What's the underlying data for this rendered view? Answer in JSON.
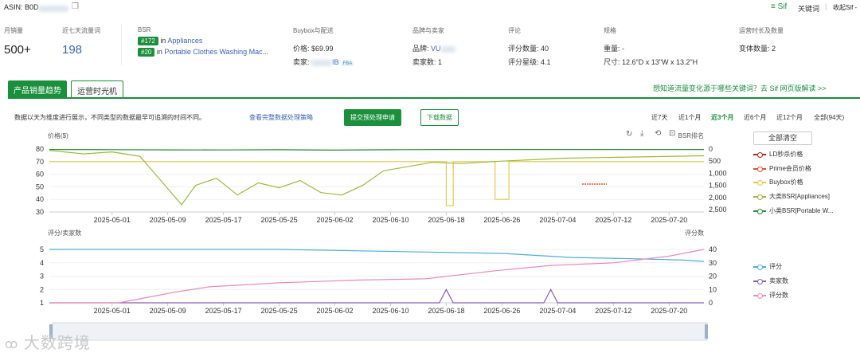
{
  "header": {
    "asin_label": "ASIN: B0D",
    "copy_icon": "copy-icon",
    "sif_logo": "≡ Sif",
    "sif_keyword": "关键词",
    "separator": "|",
    "fold_label": "收起Sif -"
  },
  "stats": {
    "monthly_sales": {
      "label": "月销量",
      "value": "500+"
    },
    "traffic7": {
      "label": "近七天流量词",
      "value": "198"
    },
    "bsr": {
      "label": "BSR",
      "rank1": "#172",
      "cat1": "Appliances",
      "rank2": "#20",
      "cat2": "Portable Clothes Washing Mac...",
      "in": "in"
    },
    "buybox": {
      "label": "Buybox与配送",
      "price_label": "价格:",
      "price": "$69.99",
      "seller_label": "卖家:",
      "seller_suffix": "IB",
      "fba": "FBA"
    },
    "brand": {
      "label": "品牌与卖家",
      "brand_label": "品牌:",
      "brand_value": "VU",
      "sellers_label": "卖家数:",
      "sellers_value": "1"
    },
    "review": {
      "label": "评论",
      "count_label": "评分数量:",
      "count": "40",
      "rating_label": "评分星级:",
      "rating": "4.1"
    },
    "spec": {
      "label": "规格",
      "weight_label": "重量:",
      "weight": "-",
      "size_label": "尺寸:",
      "size": "12.6\"D x 13\"W x 13.2\"H"
    },
    "ops": {
      "label": "运营时长及数量",
      "variants_label": "变体数量:",
      "variants": "2"
    }
  },
  "tabs": [
    "产品销量趋势",
    "运营时光机"
  ],
  "promo": "想知道流量变化源于哪些关键词？去 Sif 网页版解读 >>",
  "toolbar": {
    "note": "数据以天为维度进行展示，不同类型的数据最早可追溯的时间不同。",
    "note_link": "查看完整数据处理策略",
    "submit": "提交预处理申请",
    "download": "下载数据",
    "ranges": [
      "近7天",
      "近1个月",
      "近3个月",
      "近6个月",
      "近12个月",
      "全部(94天)"
    ],
    "active_range": "近3个月"
  },
  "legend_top": {
    "clear": "全部清空",
    "items": [
      {
        "name": "LD秒杀价格",
        "color": "#b22222"
      },
      {
        "name": "Prime会员价格",
        "color": "#e8502a"
      },
      {
        "name": "Buybox价格",
        "color": "#e8c84a"
      },
      {
        "name": "大类BSR[Appliances]",
        "color": "#9bbb3a"
      },
      {
        "name": "小类BSR[Portable W...",
        "color": "#2e8b3a"
      }
    ]
  },
  "legend_bottom": {
    "items": [
      {
        "name": "评分",
        "color": "#4aaed6"
      },
      {
        "name": "卖家数",
        "color": "#8a5fb5"
      },
      {
        "name": "评分数",
        "color": "#e88aba"
      }
    ]
  },
  "watermark": "大数跨境",
  "chart_data": [
    {
      "type": "line",
      "title": "",
      "ylabel": "价格($)",
      "y2label": "BSR排名",
      "x": [
        "2025-05-01",
        "2025-05-09",
        "2025-05-17",
        "2025-05-25",
        "2025-06-02",
        "2025-06-10",
        "2025-06-18",
        "2025-06-26",
        "2025-07-04",
        "2025-07-12",
        "2025-07-20"
      ],
      "yticks": [
        80,
        70,
        60,
        50,
        40,
        30
      ],
      "y2ticks": [
        "0",
        "500",
        "1,000",
        "1,500",
        "2,000",
        "2,500"
      ],
      "ylim": [
        30,
        80
      ],
      "y2lim": [
        0,
        2600
      ],
      "series": [
        {
          "name": "Buybox价格",
          "axis": "y",
          "dates": [
            "2025-04-22",
            "2025-05-05",
            "2025-05-05",
            "2025-06-18",
            "2025-06-18",
            "2025-06-19",
            "2025-06-19",
            "2025-06-25",
            "2025-06-25",
            "2025-06-27",
            "2025-06-27",
            "2025-07-25"
          ],
          "values": [
            69.99,
            69.99,
            69.99,
            69.99,
            35,
            35,
            69.99,
            69.99,
            40,
            40,
            69.99,
            69.99
          ]
        },
        {
          "name": "大类BSR[Appliances]",
          "axis": "y2",
          "dates": [
            "2025-04-22",
            "2025-04-27",
            "2025-05-01",
            "2025-05-05",
            "2025-05-08",
            "2025-05-11",
            "2025-05-13",
            "2025-05-16",
            "2025-05-19",
            "2025-05-22",
            "2025-05-25",
            "2025-05-28",
            "2025-05-31",
            "2025-06-03",
            "2025-06-06",
            "2025-06-09",
            "2025-06-12",
            "2025-06-16",
            "2025-06-20",
            "2025-06-26",
            "2025-07-05",
            "2025-07-15",
            "2025-07-25"
          ],
          "values": [
            60,
            200,
            120,
            300,
            1300,
            2300,
            1500,
            1200,
            1900,
            1400,
            1600,
            1300,
            1800,
            1900,
            1500,
            900,
            750,
            550,
            600,
            500,
            380,
            330,
            280
          ]
        },
        {
          "name": "小类BSR[Portable W...",
          "axis": "y2",
          "dates": [
            "2025-04-22",
            "2025-05-01",
            "2025-05-09",
            "2025-05-17",
            "2025-05-25",
            "2025-06-02",
            "2025-06-10",
            "2025-06-18",
            "2025-07-04",
            "2025-07-25"
          ],
          "values": [
            20,
            25,
            35,
            40,
            30,
            45,
            30,
            20,
            20,
            20
          ]
        }
      ]
    },
    {
      "type": "line",
      "title": "",
      "ylabel": "评分/卖家数",
      "y2label": "评分数",
      "x": [
        "2025-05-01",
        "2025-05-09",
        "2025-05-17",
        "2025-05-25",
        "2025-06-02",
        "2025-06-10",
        "2025-06-18",
        "2025-06-26",
        "2025-07-04",
        "2025-07-12",
        "2025-07-20"
      ],
      "yticks": [
        5,
        4,
        3,
        2,
        1
      ],
      "y2ticks": [
        40,
        30,
        20,
        10,
        0
      ],
      "ylim": [
        1,
        5.3
      ],
      "y2lim": [
        0,
        43
      ],
      "series": [
        {
          "name": "评分",
          "axis": "y",
          "dates": [
            "2025-04-22",
            "2025-05-25",
            "2025-06-05",
            "2025-06-26",
            "2025-07-06",
            "2025-07-15",
            "2025-07-22",
            "2025-07-25"
          ],
          "values": [
            5.0,
            5.0,
            4.9,
            4.7,
            4.4,
            4.3,
            4.2,
            4.1
          ]
        },
        {
          "name": "卖家数",
          "axis": "y",
          "dates": [
            "2025-04-22",
            "2025-06-17",
            "2025-06-18",
            "2025-06-19",
            "2025-07-02",
            "2025-07-03",
            "2025-07-04",
            "2025-07-25"
          ],
          "values": [
            1,
            1,
            2,
            1,
            1,
            2,
            1,
            1
          ]
        },
        {
          "name": "评分数",
          "axis": "y2",
          "dates": [
            "2025-04-22",
            "2025-05-02",
            "2025-05-05",
            "2025-05-10",
            "2025-05-15",
            "2025-05-25",
            "2025-06-05",
            "2025-06-15",
            "2025-06-25",
            "2025-07-03",
            "2025-07-12",
            "2025-07-20",
            "2025-07-25"
          ],
          "values": [
            0,
            0,
            3,
            8,
            12,
            15,
            17,
            18,
            24,
            28,
            30,
            35,
            40
          ]
        }
      ]
    }
  ]
}
